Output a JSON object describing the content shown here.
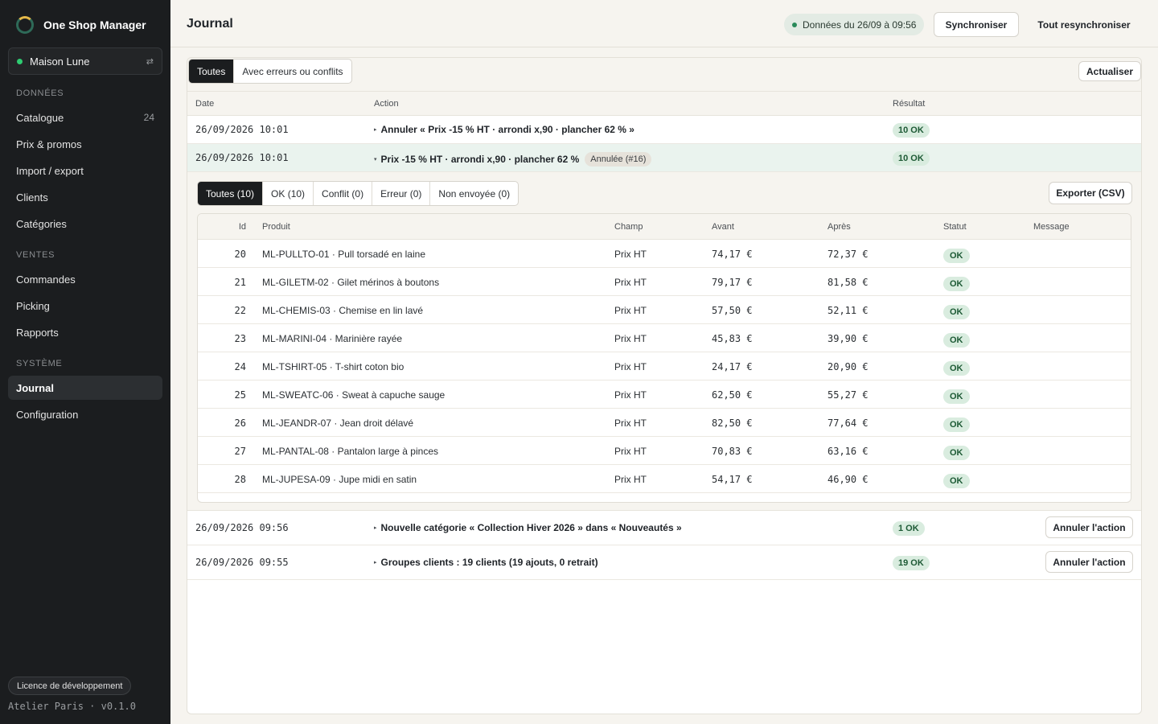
{
  "app": {
    "name": "One Shop Manager"
  },
  "store": {
    "name": "Maison Lune"
  },
  "nav": {
    "sections": [
      {
        "label": "DONNÉES",
        "items": [
          {
            "label": "Catalogue",
            "count": "24"
          },
          {
            "label": "Prix & promos"
          },
          {
            "label": "Import / export"
          },
          {
            "label": "Clients"
          },
          {
            "label": "Catégories"
          }
        ]
      },
      {
        "label": "VENTES",
        "items": [
          {
            "label": "Commandes"
          },
          {
            "label": "Picking"
          },
          {
            "label": "Rapports"
          }
        ]
      },
      {
        "label": "SYSTÈME",
        "items": [
          {
            "label": "Journal",
            "active": true
          },
          {
            "label": "Configuration"
          }
        ]
      }
    ]
  },
  "footer": {
    "license": "Licence de développement",
    "version": "Atelier Paris · v0.1.0"
  },
  "header": {
    "title": "Journal",
    "data_status": "Données du 26/09 à 09:56",
    "sync_label": "Synchroniser",
    "resync_label": "Tout resynchroniser"
  },
  "filters": {
    "tabs": [
      "Toutes",
      "Avec erreurs ou conflits"
    ],
    "active": 0,
    "refresh_label": "Actualiser"
  },
  "columns": {
    "date": "Date",
    "action": "Action",
    "result": "Résultat"
  },
  "log": [
    {
      "date": "26/09/2026 10:01",
      "action": "Annuler « Prix -15 % HT · arrondi x,90 · plancher 62 % »",
      "result": "10 OK"
    },
    {
      "date": "26/09/2026 10:01",
      "action": "Prix -15 % HT · arrondi x,90 · plancher 62 %",
      "tag": "Annulée (#16)",
      "result": "10 OK",
      "expanded": true
    },
    {
      "date": "26/09/2026 09:56",
      "action": "Nouvelle catégorie « Collection Hiver 2026 » dans « Nouveautés »",
      "result": "1 OK",
      "undo": "Annuler l'action"
    },
    {
      "date": "26/09/2026 09:55",
      "action": "Groupes clients : 19 clients (19 ajouts, 0 retrait)",
      "result": "19 OK",
      "undo": "Annuler l'action"
    }
  ],
  "detail": {
    "tabs": [
      "Toutes (10)",
      "OK (10)",
      "Conflit (0)",
      "Erreur (0)",
      "Non envoyée (0)"
    ],
    "active": 0,
    "export_label": "Exporter (CSV)",
    "columns": {
      "id": "Id",
      "product": "Produit",
      "field": "Champ",
      "before": "Avant",
      "after": "Après",
      "status": "Statut",
      "message": "Message"
    },
    "rows": [
      {
        "id": "20",
        "product": "ML-PULLTO-01 · Pull torsadé en laine",
        "field": "Prix HT",
        "before": "74,17 €",
        "after": "72,37 €",
        "status": "OK"
      },
      {
        "id": "21",
        "product": "ML-GILETM-02 · Gilet mérinos à boutons",
        "field": "Prix HT",
        "before": "79,17 €",
        "after": "81,58 €",
        "status": "OK"
      },
      {
        "id": "22",
        "product": "ML-CHEMIS-03 · Chemise en lin lavé",
        "field": "Prix HT",
        "before": "57,50 €",
        "after": "52,11 €",
        "status": "OK"
      },
      {
        "id": "23",
        "product": "ML-MARINI-04 · Marinière rayée",
        "field": "Prix HT",
        "before": "45,83 €",
        "after": "39,90 €",
        "status": "OK"
      },
      {
        "id": "24",
        "product": "ML-TSHIRT-05 · T-shirt coton bio",
        "field": "Prix HT",
        "before": "24,17 €",
        "after": "20,90 €",
        "status": "OK"
      },
      {
        "id": "25",
        "product": "ML-SWEATC-06 · Sweat à capuche sauge",
        "field": "Prix HT",
        "before": "62,50 €",
        "after": "55,27 €",
        "status": "OK"
      },
      {
        "id": "26",
        "product": "ML-JEANDR-07 · Jean droit délavé",
        "field": "Prix HT",
        "before": "82,50 €",
        "after": "77,64 €",
        "status": "OK"
      },
      {
        "id": "27",
        "product": "ML-PANTAL-08 · Pantalon large à pinces",
        "field": "Prix HT",
        "before": "70,83 €",
        "after": "63,16 €",
        "status": "OK"
      },
      {
        "id": "28",
        "product": "ML-JUPESA-09 · Jupe midi en satin",
        "field": "Prix HT",
        "before": "54,17 €",
        "after": "46,90 €",
        "status": "OK"
      }
    ]
  }
}
